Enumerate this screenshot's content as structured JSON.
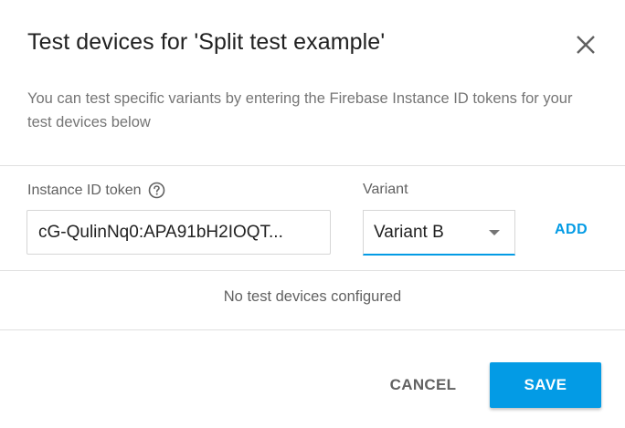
{
  "dialog": {
    "title": "Test devices for 'Split test example'",
    "description": "You can test specific variants by entering the Firebase Instance ID tokens for your test devices below",
    "close_icon": "close-icon"
  },
  "form": {
    "token_label": "Instance ID token",
    "help_icon": "help-circle-icon",
    "token_value": "cG-QulinNq0:APA91bH2IOQT...",
    "variant_label": "Variant",
    "variant_value": "Variant B",
    "dropdown_icon": "dropdown-arrow-icon",
    "add_label": "ADD"
  },
  "list": {
    "empty_text": "No test devices configured"
  },
  "actions": {
    "cancel_label": "CANCEL",
    "save_label": "SAVE"
  },
  "colors": {
    "accent": "#039be5",
    "text_primary": "#212121",
    "text_secondary": "#757575",
    "divider": "#e0e0e0"
  }
}
